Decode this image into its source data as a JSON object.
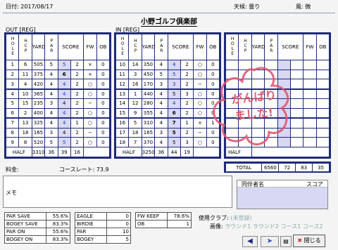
{
  "header": {
    "date": "日付: 2017/08/17",
    "weather": "天候: 曇り",
    "wind": "風: 微"
  },
  "title": "小野ゴルフ倶楽部",
  "out_label": "OUT [REG]",
  "in_label": "IN [REG]",
  "columns": {
    "hole": "HOLE",
    "hcp": "HCP",
    "yard": "YARD",
    "par": "PAR",
    "score": "SCORE",
    "fw": "FW",
    "ob": "OB"
  },
  "out_rows": [
    {
      "hole": "1",
      "hcp": "6",
      "yard": "505",
      "par": "5",
      "score": "5",
      "putt": "2",
      "fw": "×",
      "ob": "0"
    },
    {
      "hole": "2",
      "hcp": "11",
      "yard": "375",
      "par": "4",
      "score": "6",
      "putt": "2",
      "fw": "×",
      "ob": "0"
    },
    {
      "hole": "3",
      "hcp": "4",
      "yard": "420",
      "par": "4",
      "score": "4",
      "putt": "2",
      "fw": "○",
      "ob": "0"
    },
    {
      "hole": "4",
      "hcp": "10",
      "yard": "365",
      "par": "4",
      "score": "4",
      "putt": "2",
      "fw": "○",
      "ob": "0"
    },
    {
      "hole": "5",
      "hcp": "15",
      "yard": "235",
      "par": "3",
      "score": "4",
      "putt": "2",
      "fw": "−",
      "ob": "0"
    },
    {
      "hole": "6",
      "hcp": "2",
      "yard": "400",
      "par": "4",
      "score": "4",
      "putt": "2",
      "fw": "○",
      "ob": "0"
    },
    {
      "hole": "7",
      "hcp": "13",
      "yard": "325",
      "par": "4",
      "score": "4",
      "putt": "1",
      "fw": "○",
      "ob": "0"
    },
    {
      "hole": "8",
      "hcp": "18",
      "yard": "165",
      "par": "3",
      "score": "4",
      "putt": "2",
      "fw": "−",
      "ob": "0"
    },
    {
      "hole": "9",
      "hcp": "8",
      "yard": "520",
      "par": "5",
      "score": "5",
      "putt": "2",
      "fw": "○",
      "ob": "0"
    }
  ],
  "out_half": {
    "label": "HALF",
    "yard": "3310",
    "par": "36",
    "score": "39",
    "putt": "16"
  },
  "in_rows": [
    {
      "hole": "10",
      "hcp": "14",
      "yard": "350",
      "par": "4",
      "score": "4",
      "putt": "2",
      "fw": "○",
      "ob": "0"
    },
    {
      "hole": "11",
      "hcp": "3",
      "yard": "450",
      "par": "5",
      "score": "5",
      "putt": "2",
      "fw": "○",
      "ob": "0"
    },
    {
      "hole": "12",
      "hcp": "16",
      "yard": "170",
      "par": "3",
      "score": "3",
      "putt": "2",
      "fw": "−",
      "ob": "0"
    },
    {
      "hole": "13",
      "hcp": "1",
      "yard": "440",
      "par": "4",
      "score": "5",
      "putt": "3",
      "fw": "○",
      "ob": "0"
    },
    {
      "hole": "14",
      "hcp": "12",
      "yard": "280",
      "par": "4",
      "score": "4",
      "putt": "2",
      "fw": "○",
      "ob": "0"
    },
    {
      "hole": "15",
      "hcp": "9",
      "yard": "355",
      "par": "4",
      "score": "6",
      "putt": "2",
      "fw": "○",
      "ob": "0"
    },
    {
      "hole": "16",
      "hcp": "5",
      "yard": "310",
      "par": "4",
      "score": "7",
      "putt": "1",
      "fw": "×",
      "ob": "1"
    },
    {
      "hole": "17",
      "hcp": "18",
      "yard": "165",
      "par": "3",
      "score": "5",
      "putt": "2",
      "fw": "−",
      "ob": "0"
    },
    {
      "hole": "18",
      "hcp": "7",
      "yard": "370",
      "par": "4",
      "score": "5",
      "putt": "3",
      "fw": "○",
      "ob": "0"
    }
  ],
  "in_half": {
    "label": "HALF",
    "yard": "3250",
    "par": "36",
    "score": "44",
    "putt": "19"
  },
  "extra_half_label": "HALF",
  "total": {
    "label": "TOTAL",
    "yard": "6560",
    "par": "72",
    "score": "83",
    "putt": "35"
  },
  "fee_label": "料金:",
  "course_rate": "コースレート:  73.9",
  "stamp_text": [
    "がんばり",
    "ました!"
  ],
  "memo_label": "メモ",
  "companion": {
    "name_header": "同伴者名",
    "score_header": "スコア"
  },
  "stats": [
    [
      {
        "l": "PAR SAVE",
        "v": "55.6%"
      },
      {
        "l": "EAGLE",
        "v": "0"
      },
      {
        "l": "FW KEEP",
        "v": "78.6%"
      }
    ],
    [
      {
        "l": "BOGEY SAVE",
        "v": "83.3%"
      },
      {
        "l": "BIRDIE",
        "v": "0"
      },
      {
        "l": "OB",
        "v": "1"
      }
    ],
    [
      {
        "l": "PAR ON",
        "v": "55.6%"
      },
      {
        "l": "PAR",
        "v": "10"
      }
    ],
    [
      {
        "l": "BOGEY ON",
        "v": "83.3%"
      },
      {
        "l": "BOGEY",
        "v": "5"
      }
    ]
  ],
  "clubs": {
    "used_label": "使用クラブ:",
    "used_value": "(未登録)",
    "image_label": "画像:",
    "round1": "ラウンド1",
    "round2": "ラウンド2",
    "course1": "コース1",
    "course2": "コース2"
  },
  "close_label": "閉じる",
  "colors": {
    "border": "#1e2a7a",
    "highlight": "#d8d8f4",
    "stamp": "#e05870",
    "under_par": "#1040c0"
  }
}
